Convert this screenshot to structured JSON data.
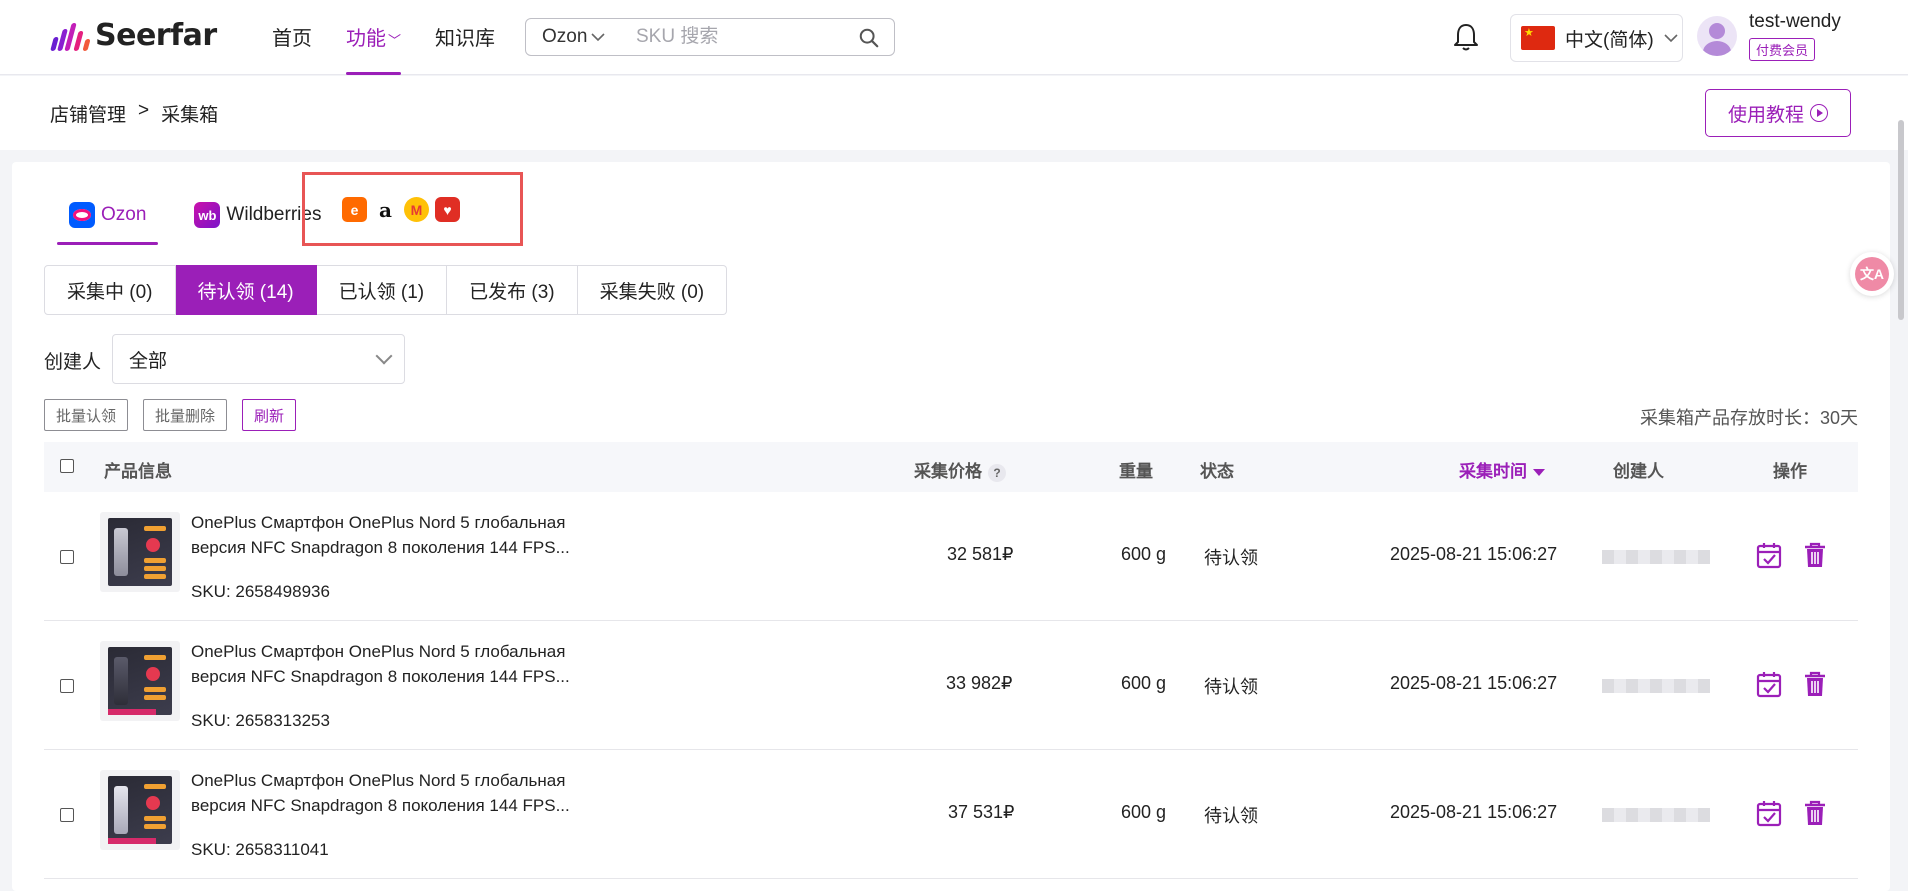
{
  "header": {
    "logo_text": "Seerfar",
    "nav": [
      {
        "label": "首页"
      },
      {
        "label": "功能"
      },
      {
        "label": "知识库"
      }
    ],
    "search": {
      "platform": "Ozon",
      "placeholder": "SKU 搜索"
    },
    "language": "中文(简体)",
    "user": {
      "name": "test-wendy",
      "badge": "付费会员"
    }
  },
  "breadcrumb": {
    "items": [
      "店铺管理",
      ">",
      "采集箱"
    ]
  },
  "tutorial_button": "使用教程",
  "platform_tabs": [
    {
      "label": "Ozon",
      "active": true
    },
    {
      "label": "Wildberries",
      "active": false
    }
  ],
  "extra_platform_icons": [
    "1688-icon",
    "amazon-icon",
    "megamarket-icon",
    "pinduoduo-icon"
  ],
  "status_tabs": [
    {
      "label": "采集中 (0)",
      "active": false
    },
    {
      "label": "待认领 (14)",
      "active": true
    },
    {
      "label": "已认领 (1)",
      "active": false
    },
    {
      "label": "已发布 (3)",
      "active": false
    },
    {
      "label": "采集失败 (0)",
      "active": false
    }
  ],
  "filter": {
    "creator_label": "创建人",
    "creator_value": "全部"
  },
  "actions": {
    "batch_claim": "批量认领",
    "batch_delete": "批量删除",
    "refresh": "刷新"
  },
  "retention_note": "采集箱产品存放时长：30天",
  "table": {
    "columns": {
      "product": "产品信息",
      "price": "采集价格",
      "weight": "重量",
      "status": "状态",
      "time": "采集时间",
      "creator": "创建人",
      "actions": "操作"
    },
    "rows": [
      {
        "title": "OnePlus Смартфон OnePlus Nord 5 глобальная версия NFC Snapdragon 8 поколения 144 FPS...",
        "sku": "SKU: 2658498936",
        "price": "32 581₽",
        "weight": "600 g",
        "status": "待认领",
        "time": "2025-08-21 15:06:27"
      },
      {
        "title": "OnePlus Смартфон OnePlus Nord 5 глобальная версия NFC Snapdragon 8 поколения 144 FPS...",
        "sku": "SKU: 2658313253",
        "price": "33 982₽",
        "weight": "600 g",
        "status": "待认领",
        "time": "2025-08-21 15:06:27"
      },
      {
        "title": "OnePlus Смартфон OnePlus Nord 5 глобальная версия NFC Snapdragon 8 поколения 144 FPS...",
        "sku": "SKU: 2658311041",
        "price": "37 531₽",
        "weight": "600 g",
        "status": "待认领",
        "time": "2025-08-21 15:06:27"
      }
    ]
  },
  "colors": {
    "accent": "#9b1fb8",
    "highlight_border": "#e85555"
  }
}
